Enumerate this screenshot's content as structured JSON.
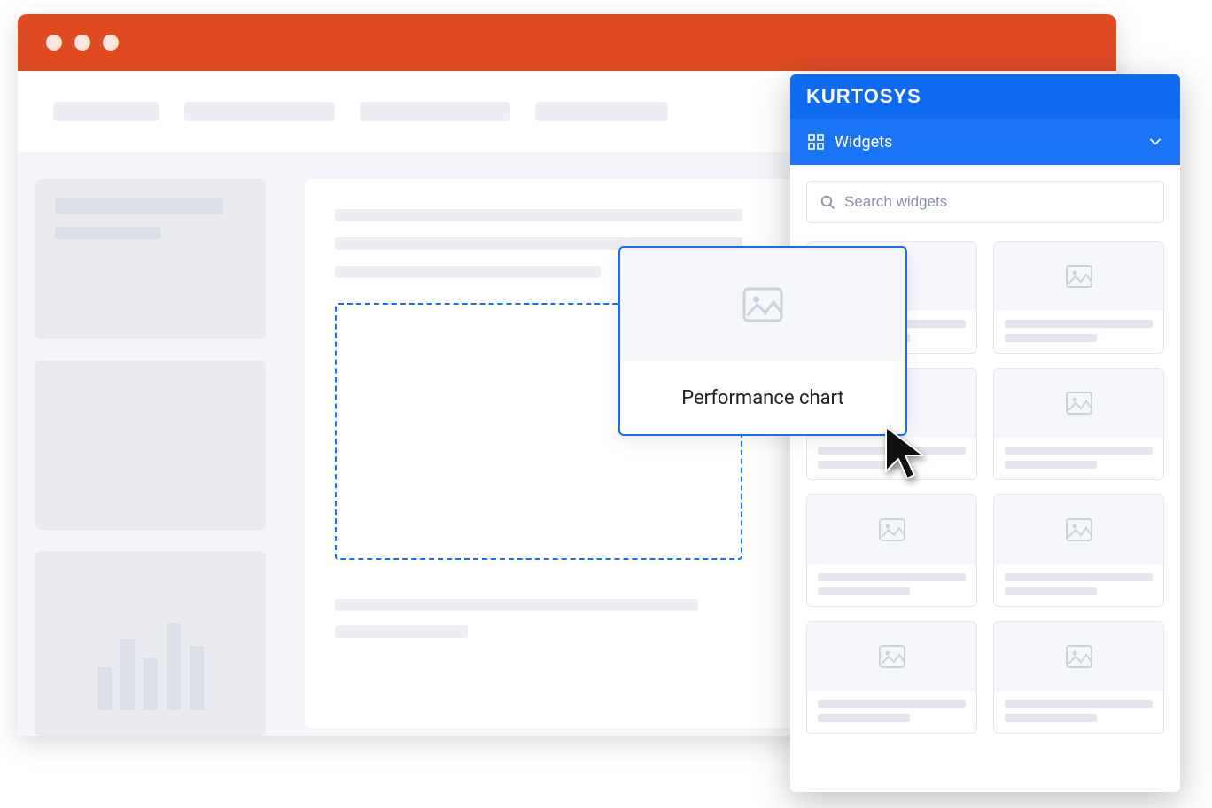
{
  "panel": {
    "brand": "KURTOSYS",
    "section_label": "Widgets",
    "search_placeholder": "Search widgets"
  },
  "drag": {
    "label": "Performance chart"
  },
  "colors": {
    "title_bar": "#de4b23",
    "accent": "#1570ef",
    "panel_brand": "#0f6af2",
    "panel_header": "#1a74f5"
  }
}
